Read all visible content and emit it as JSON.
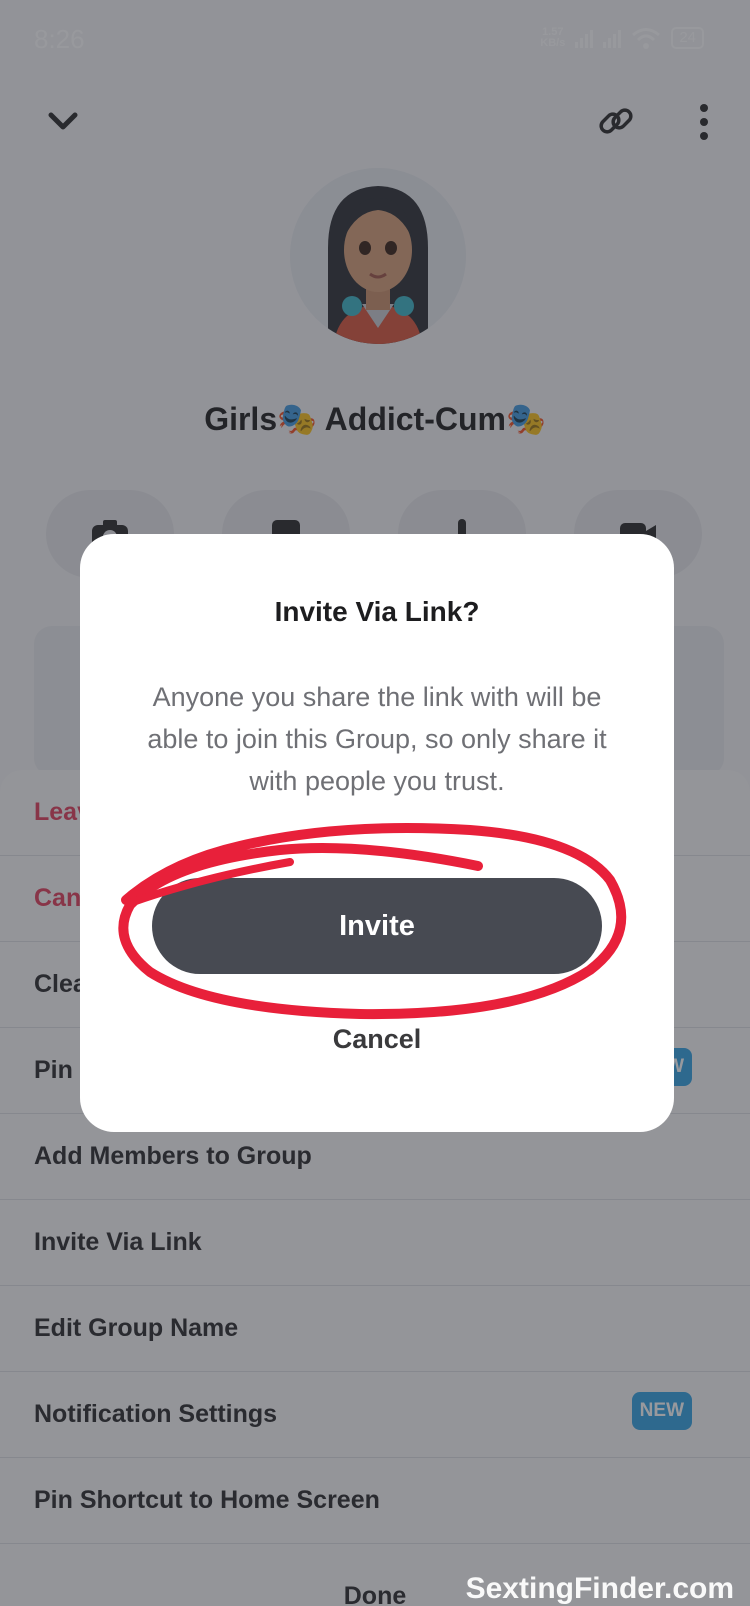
{
  "status_bar": {
    "time": "8:26",
    "net_speed_value": "1.57",
    "net_speed_unit": "KB/s",
    "battery": "24"
  },
  "header": {
    "back_icon": "chevron-down-icon",
    "link_icon": "link-icon",
    "menu_icon": "more-vertical-icon"
  },
  "group": {
    "name": "Girls🎭 Addict-Cum🎭"
  },
  "actions": [
    {
      "icon": "camera-icon"
    },
    {
      "icon": "chat-icon"
    },
    {
      "icon": "phone-icon"
    },
    {
      "icon": "video-icon"
    }
  ],
  "sheet": {
    "items": [
      {
        "label": "Leave Group",
        "danger": true
      },
      {
        "label": "Cancel",
        "danger": true
      },
      {
        "label": "Clear",
        "danger": false
      },
      {
        "label": "Pin",
        "danger": false,
        "badge": "NEW"
      },
      {
        "label": "Add Members to Group",
        "danger": false
      },
      {
        "label": "Invite Via Link",
        "danger": false
      },
      {
        "label": "Edit Group Name",
        "danger": false
      },
      {
        "label": "Notification Settings",
        "danger": false,
        "badge": "NEW"
      },
      {
        "label": "Pin Shortcut to Home Screen",
        "danger": false
      }
    ],
    "done_label": "Done"
  },
  "dialog": {
    "title": "Invite Via Link?",
    "body": "Anyone you share the link with will be able to join this Group, so only share it with people you trust.",
    "primary_label": "Invite",
    "secondary_label": "Cancel"
  },
  "watermark": "SextingFinder.com",
  "colors": {
    "danger": "#e0405c",
    "badge": "#35a3e3",
    "button": "#474a52",
    "scribble": "#e8203a"
  }
}
